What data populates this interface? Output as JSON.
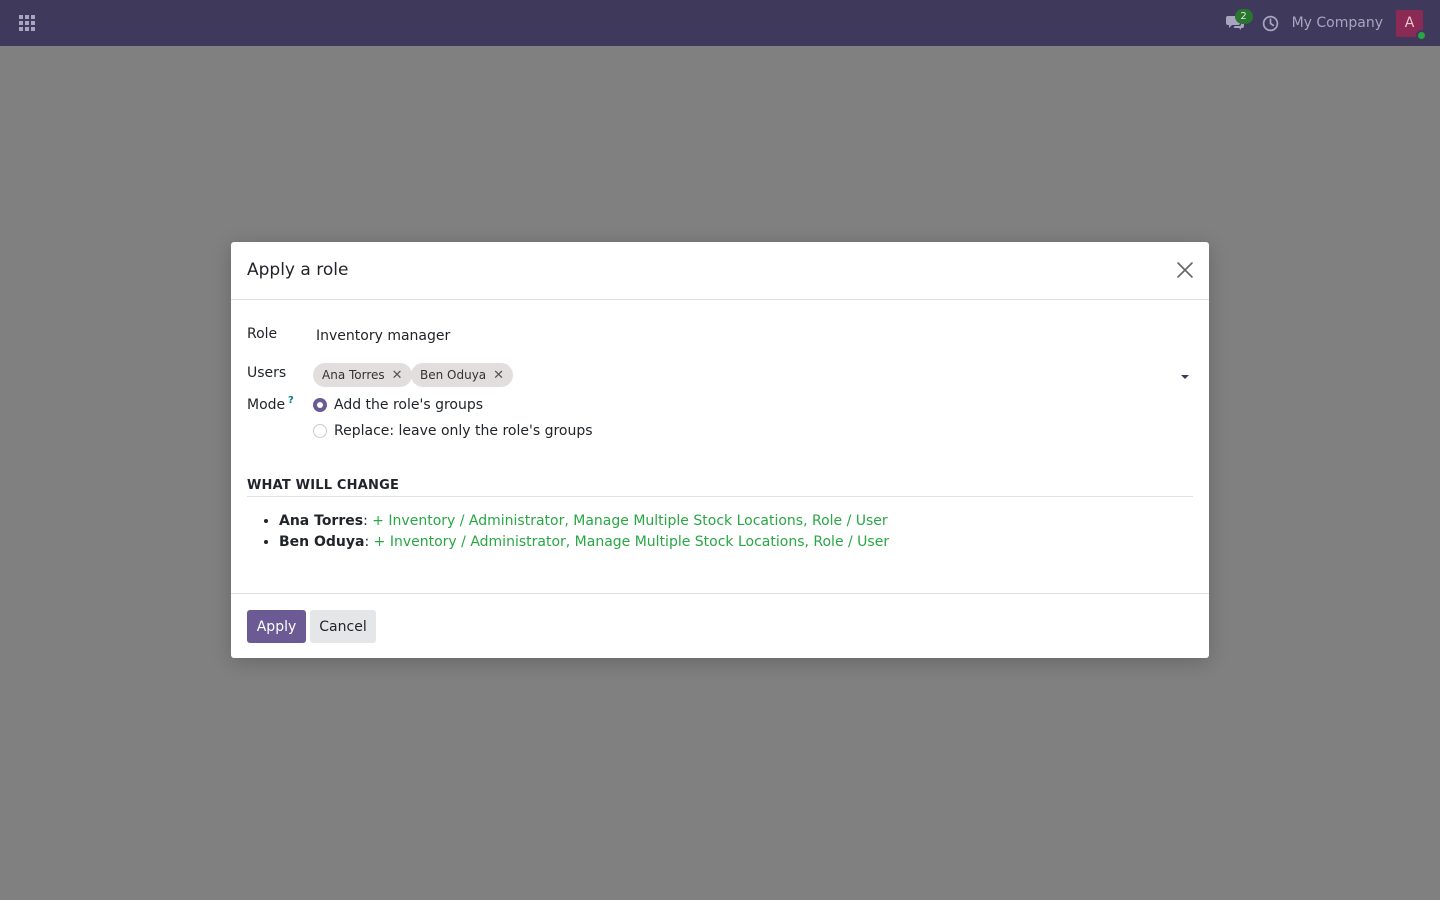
{
  "navbar": {
    "chat_badge": "2",
    "company": "My Company",
    "avatar_initial": "A",
    "icons": [
      "apps-grid-icon",
      "chat-icon",
      "clock-icon"
    ]
  },
  "dialog": {
    "title": "Apply a role",
    "fields": {
      "role_label": "Role",
      "role_value": "Inventory manager",
      "users_label": "Users",
      "users": [
        {
          "name": "Ana Torres"
        },
        {
          "name": "Ben Oduya"
        }
      ],
      "remove_tag_glyph": "✕",
      "mode_label": "Mode",
      "mode_help": "?",
      "mode_options": [
        {
          "label": "Add the role's groups",
          "selected": true
        },
        {
          "label": "Replace: leave only the role's groups",
          "selected": false
        }
      ]
    },
    "changes_section": {
      "title": "WHAT WILL CHANGE",
      "items": [
        {
          "user": "Ana Torres",
          "separator": ": ",
          "diff": "+ Inventory / Administrator, Manage Multiple Stock Locations, Role / User"
        },
        {
          "user": "Ben Oduya",
          "separator": ": ",
          "diff": "+ Inventory / Administrator, Manage Multiple Stock Locations, Role / User"
        }
      ]
    },
    "footer": {
      "apply_label": "Apply",
      "cancel_label": "Cancel"
    }
  },
  "colors": {
    "navbar_bg": "#3f3a5b",
    "backdrop": "#808080",
    "primary": "#6b5a93",
    "diff_green": "#28a745",
    "avatar_bg": "#8b2a55"
  }
}
